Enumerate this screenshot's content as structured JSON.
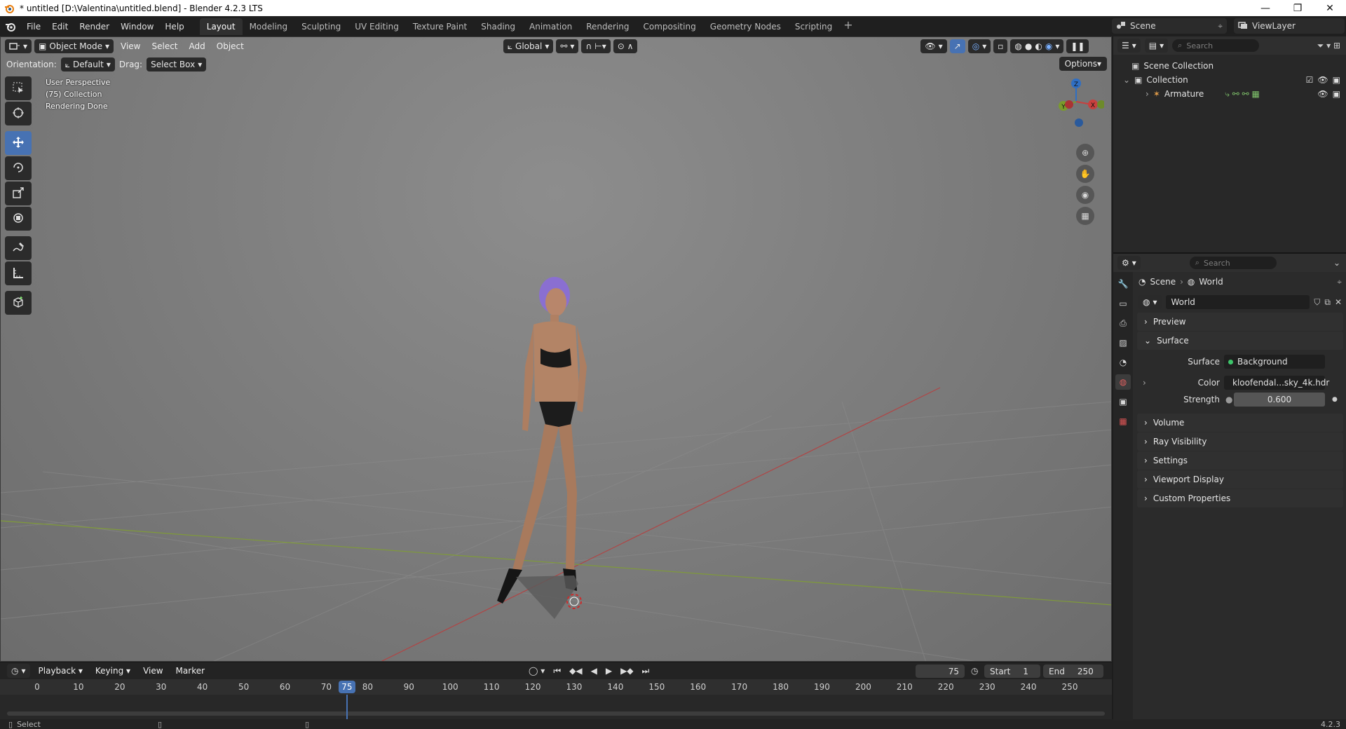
{
  "window": {
    "title": "* untitled [D:\\Valentina\\untitled.blend] - Blender 4.2.3 LTS",
    "controls": [
      "—",
      "❐",
      "✕"
    ]
  },
  "menu": {
    "items": [
      "File",
      "Edit",
      "Render",
      "Window",
      "Help"
    ]
  },
  "workspaces": {
    "tabs": [
      "Layout",
      "Modeling",
      "Sculpting",
      "UV Editing",
      "Texture Paint",
      "Shading",
      "Animation",
      "Rendering",
      "Compositing",
      "Geometry Nodes",
      "Scripting"
    ],
    "active": "Layout",
    "plus": "+"
  },
  "scene": {
    "name": "Scene",
    "view_layer": "ViewLayer"
  },
  "viewport": {
    "mode": "Object Mode",
    "menus": [
      "View",
      "Select",
      "Add",
      "Object"
    ],
    "transform_orientation": "Global",
    "orientation_label": "Orientation:",
    "orientation_value": "Default",
    "drag_label": "Drag:",
    "drag_value": "Select Box",
    "options_label": "Options",
    "info_lines": [
      "User Perspective",
      "(75) Collection",
      "Rendering Done"
    ],
    "gizmo_axes": {
      "z": "Z",
      "y": "Y",
      "x": "X"
    },
    "colors": {
      "x_axis": "#c8403e",
      "y_axis": "#7a9c2b",
      "z_axis": "#2f6fc4",
      "active_tool": "#4772b3"
    }
  },
  "timeline": {
    "menus": [
      "Playback",
      "Keying",
      "View",
      "Marker"
    ],
    "current_frame": "75",
    "start_label": "Start",
    "start": "1",
    "end_label": "End",
    "end": "250",
    "ticks": [
      "0",
      "10",
      "20",
      "30",
      "40",
      "50",
      "60",
      "70",
      "80",
      "90",
      "100",
      "110",
      "120",
      "130",
      "140",
      "150",
      "160",
      "170",
      "180",
      "190",
      "200",
      "210",
      "220",
      "230",
      "240",
      "250"
    ],
    "playhead": "75"
  },
  "statusbar": {
    "left": "Select",
    "version": "4.2.3"
  },
  "outliner": {
    "search_placeholder": "Search",
    "scene_collection": "Scene Collection",
    "collection": "Collection",
    "armature": "Armature"
  },
  "properties": {
    "search_placeholder": "Search",
    "breadcrumb": [
      "Scene",
      "World"
    ],
    "world_name": "World",
    "panels": [
      "Preview",
      "Surface",
      "Volume",
      "Ray Visibility",
      "Settings",
      "Viewport Display",
      "Custom Properties"
    ],
    "surface_label": "Surface",
    "surface_value": "Background",
    "color_label": "Color",
    "color_value": "kloofendal...sky_4k.hdr",
    "strength_label": "Strength",
    "strength_value": "0.600"
  }
}
